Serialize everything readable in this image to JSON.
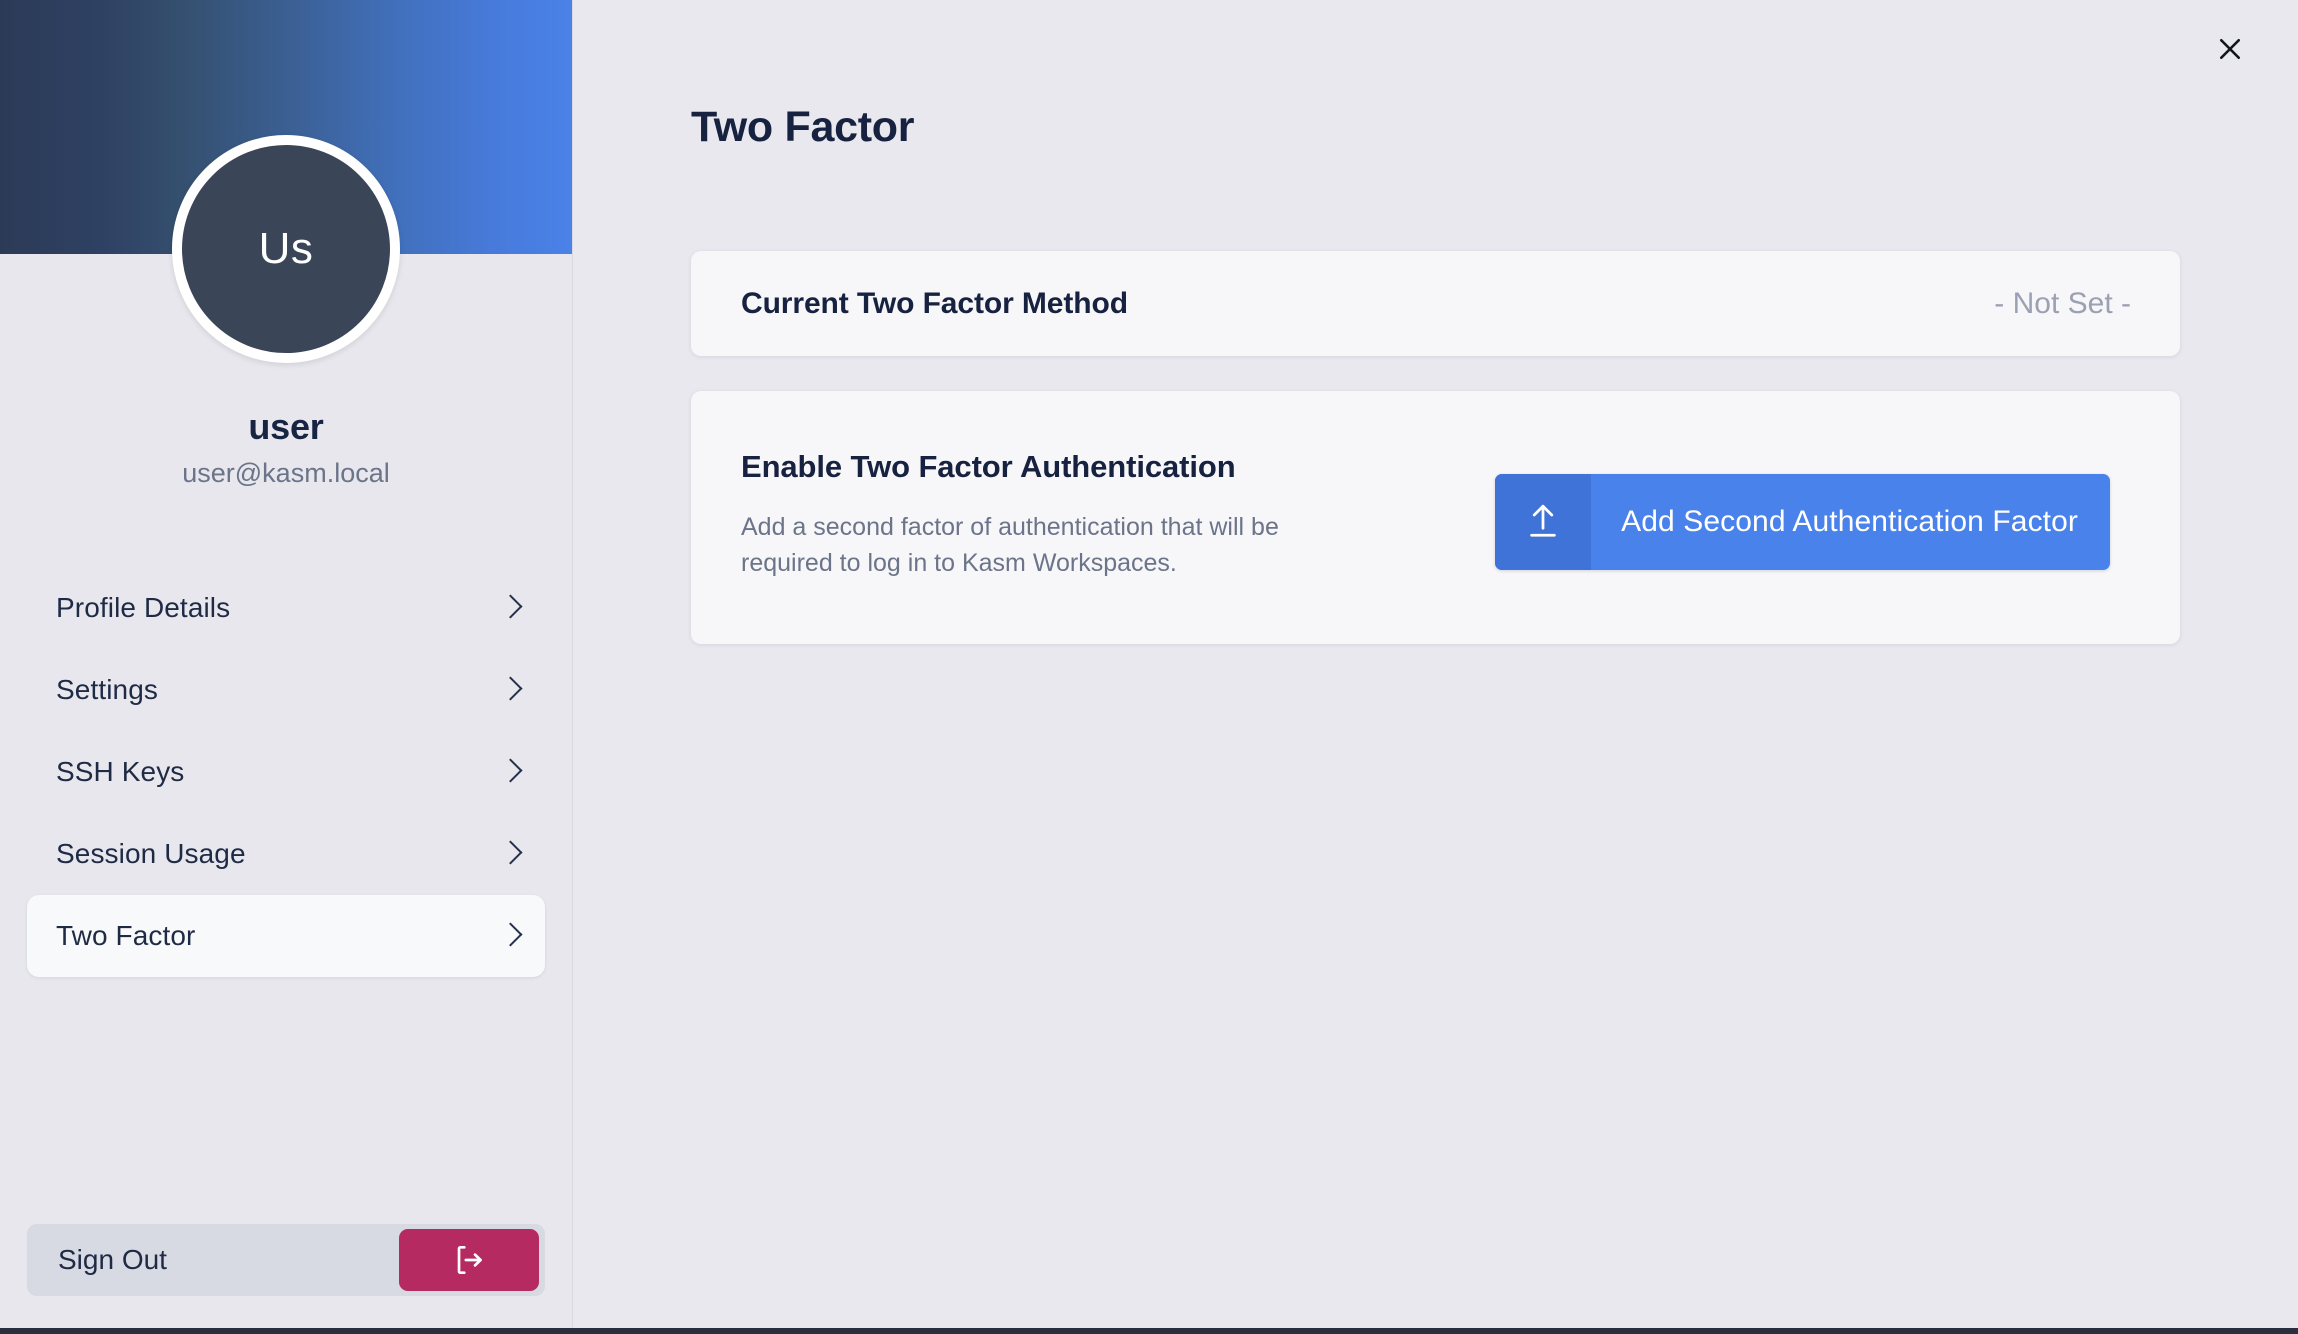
{
  "sidebar": {
    "avatar_initials": "Us",
    "user_name": "user",
    "user_email": "user@kasm.local",
    "nav_items": [
      {
        "label": "Profile Details",
        "icon": "chevron-right-icon",
        "active": false
      },
      {
        "label": "Settings",
        "icon": "chevron-right-icon",
        "active": false
      },
      {
        "label": "SSH Keys",
        "icon": "chevron-right-icon",
        "active": false
      },
      {
        "label": "Session Usage",
        "icon": "chevron-right-icon",
        "active": false
      },
      {
        "label": "Two Factor",
        "icon": "chevron-right-icon",
        "active": true
      }
    ],
    "signout_label": "Sign Out",
    "signout_icon": "logout-icon"
  },
  "main": {
    "close_icon": "close-icon",
    "page_title": "Two Factor",
    "current_method_card": {
      "title": "Current Two Factor Method",
      "value": "- Not Set -"
    },
    "enable_card": {
      "title": "Enable Two Factor Authentication",
      "description": "Add a second factor of authentication that will be required to log in to Kasm Workspaces.",
      "button_label": "Add Second Authentication Factor",
      "button_icon": "upload-arrow-icon"
    }
  },
  "colors": {
    "header_gradient_start": "#2b3b57",
    "header_gradient_end": "#4a82e8",
    "avatar_bg": "#3b4558",
    "accent_blue": "#4a82ec",
    "accent_blue_dark": "#3f73d8",
    "signout_crimson": "#b52a61",
    "page_bg": "#e8e8ee",
    "card_bg": "#f7f7f9",
    "text_dark": "#16223f",
    "text_muted": "#6b7489",
    "value_muted": "#9ba1b2"
  }
}
